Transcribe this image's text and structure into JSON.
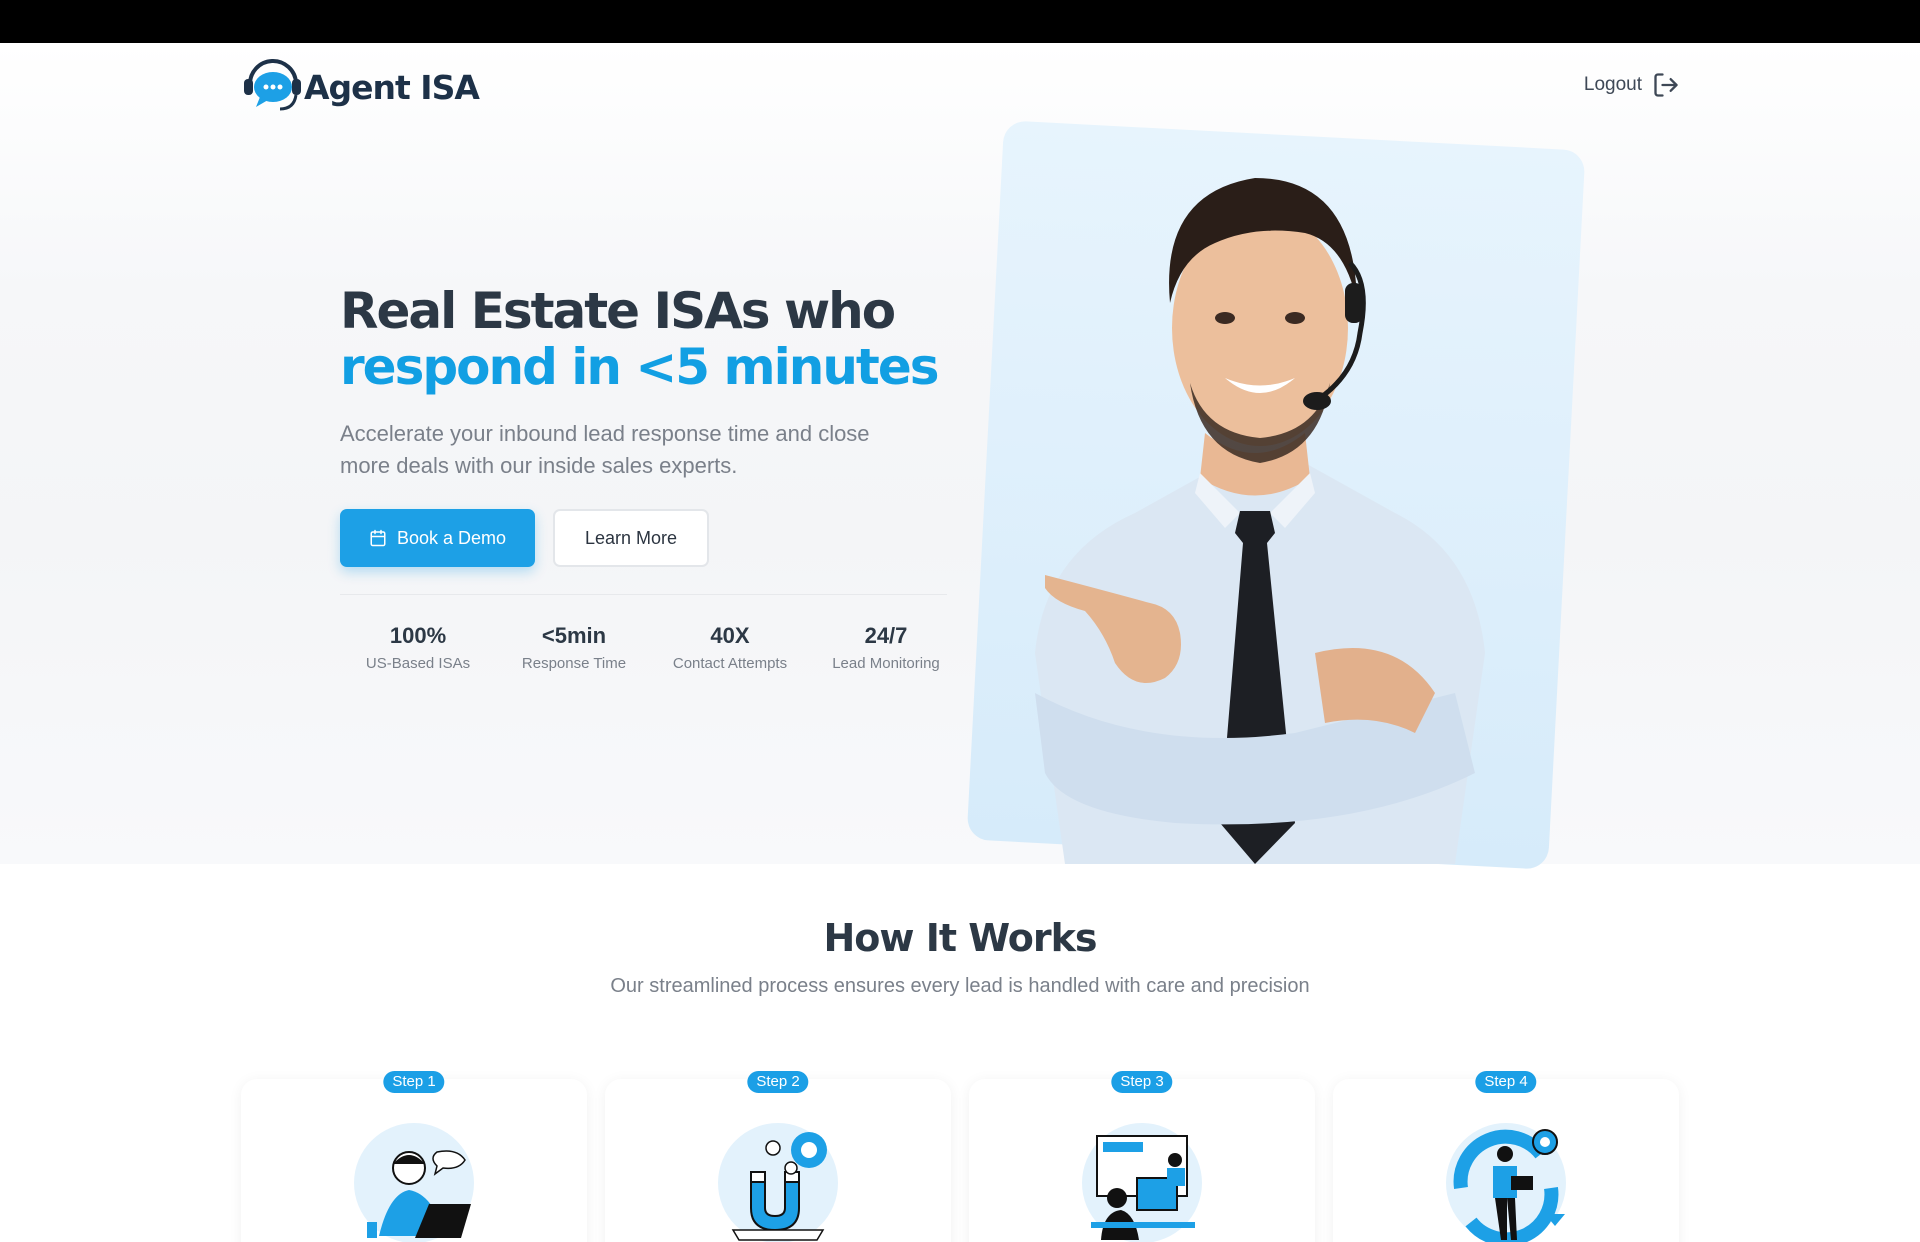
{
  "brand": {
    "name": "Agent ISA",
    "logo_icon": "chat-headset-icon",
    "primary_color": "#1da0e6",
    "dark_color": "#2c3845"
  },
  "nav": {
    "logout_label": "Logout",
    "logout_icon": "logout-icon"
  },
  "hero": {
    "headline_line1": "Real Estate ISAs who",
    "headline_line2": "respond in <5 minutes",
    "subtitle": "Accelerate your inbound lead response time and close more deals with our inside sales experts.",
    "primary_button": "Book a Demo",
    "primary_button_icon": "calendar-icon",
    "secondary_button": "Learn More",
    "stats": [
      {
        "value": "100%",
        "label": "US-Based ISAs"
      },
      {
        "value": "<5min",
        "label": "Response Time"
      },
      {
        "value": "40X",
        "label": "Contact Attempts"
      },
      {
        "value": "24/7",
        "label": "Lead Monitoring"
      }
    ]
  },
  "how_it_works": {
    "title": "How It Works",
    "subtitle": "Our streamlined process ensures every lead is handled with care and precision",
    "steps": [
      {
        "badge": "Step 1"
      },
      {
        "badge": "Step 2"
      },
      {
        "badge": "Step 3"
      },
      {
        "badge": "Step 4"
      }
    ]
  }
}
